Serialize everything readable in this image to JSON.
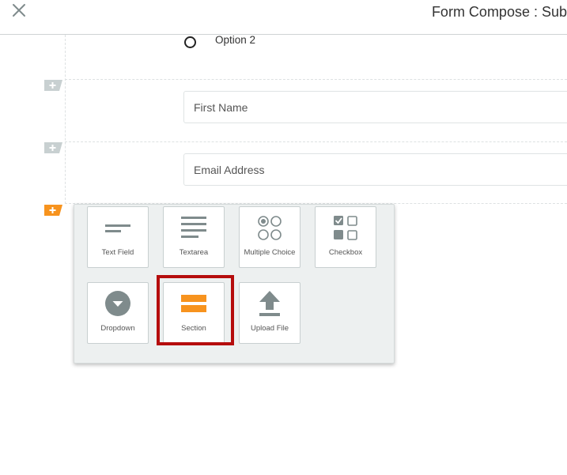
{
  "header": {
    "title": "Form Compose : Sub",
    "close_icon": "close-icon"
  },
  "form": {
    "radio_option_label": "Option 2",
    "first_name_placeholder": "First Name",
    "email_placeholder": "Email Address"
  },
  "add_buttons": [
    {
      "icon": "add-field-icon",
      "color": "#c8d0d1"
    },
    {
      "icon": "add-field-icon",
      "color": "#c8d0d1"
    },
    {
      "icon": "add-field-icon",
      "color": "#f7931e"
    }
  ],
  "palette": {
    "items": [
      {
        "label": "Text Field",
        "icon": "text-field-icon"
      },
      {
        "label": "Textarea",
        "icon": "textarea-icon"
      },
      {
        "label": "Multiple Choice",
        "icon": "multiple-choice-icon"
      },
      {
        "label": "Checkbox",
        "icon": "checkbox-icon"
      },
      {
        "label": "Dropdown",
        "icon": "dropdown-icon"
      },
      {
        "label": "Section",
        "icon": "section-icon",
        "highlighted": true
      },
      {
        "label": "Upload File",
        "icon": "upload-file-icon"
      }
    ]
  },
  "colors": {
    "accent": "#f7931e",
    "icon_gray": "#7f8b8c",
    "highlight_border": "#b50d0d"
  }
}
